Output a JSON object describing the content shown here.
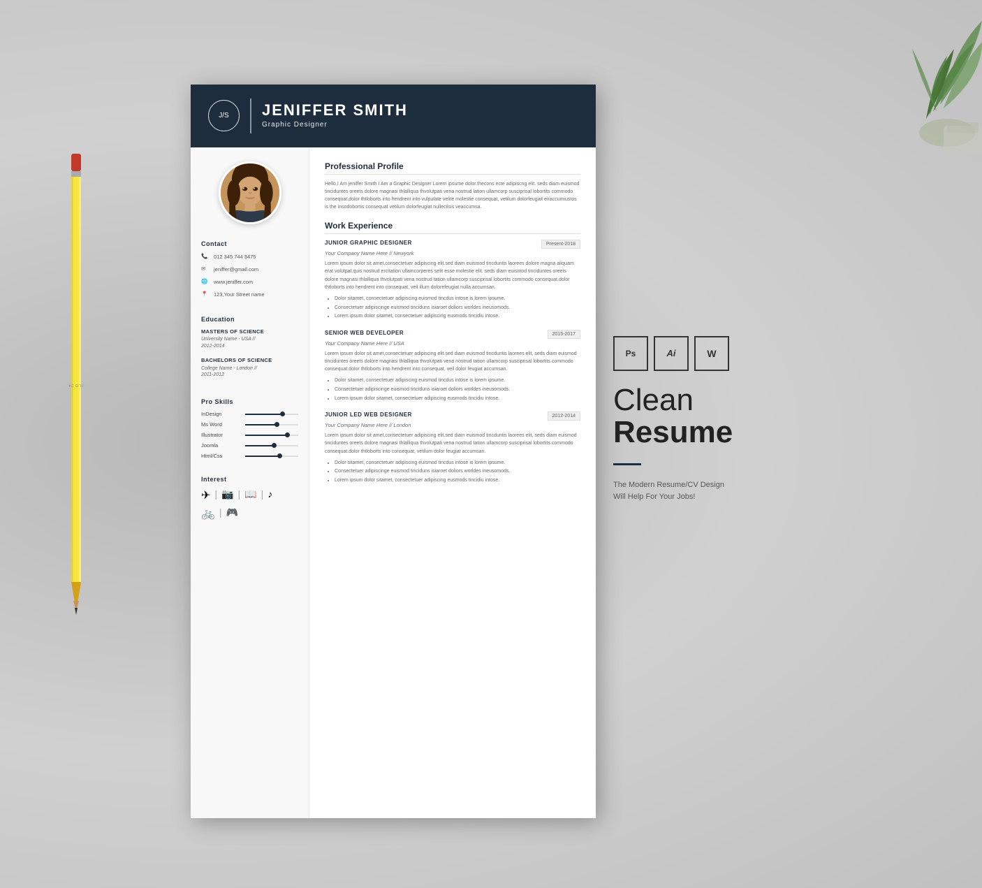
{
  "header": {
    "monogram": "J/S",
    "name": "JENIFFER SMITH",
    "title": "Graphic Designer"
  },
  "contact": {
    "section_title": "Contact",
    "phone": "012 345 744 3475",
    "email": "jeniffer@gmail.com",
    "website": "www.jeniffer.com",
    "address": "123,Your Street name"
  },
  "education": {
    "section_title": "Education",
    "entries": [
      {
        "degree": "MASTERS OF SCIENCE",
        "detail": "University Name - USA // 2012-2014"
      },
      {
        "degree": "BACHELORS OF SCIENCE",
        "detail": "College Name - London // 2011-2012"
      }
    ]
  },
  "skills": {
    "section_title": "Pro Skills",
    "items": [
      {
        "name": "InDesign",
        "percent": 70
      },
      {
        "name": "Ms Word",
        "percent": 60
      },
      {
        "name": "Illustrator",
        "percent": 80
      },
      {
        "name": "Joomla",
        "percent": 55
      },
      {
        "name": "Html/Css",
        "percent": 65
      }
    ]
  },
  "interest": {
    "section_title": "Interest",
    "icons": [
      "✈",
      "|",
      "📷",
      "|",
      "📖",
      "|",
      "♪",
      "🚲",
      "|",
      "🎮"
    ]
  },
  "profile": {
    "section_title": "Professional Profile",
    "text": "Hello,I Am jeniffer Smith I Am a Graphic Designer Lorem ipsume dolor.thecons ecte adipiscng elit. seds diam euismod tinciduntes oreets dolore magnasi thlalliqua thvolutpati vena nostrud lation ullamcorp susciprisal lobortits  commodo consequat.dolor thtloborts into hendrent into vulputate velite molestie consequat, vetilum dolorfeugait eiraccumiustos is the insodobortis consequat vetilum dolorfeugiat nullecilsis veaccumsa."
  },
  "experience": {
    "section_title": "Work Experience",
    "jobs": [
      {
        "title": "JUNIOR GRAPHIC DESIGNER",
        "date": "Present-2018",
        "company": "Your Company Name Here // Newyork",
        "description": "Lorem ipsum dolor sit amet,consectetuer adipiscing elit.sed diam euismod tincduntis laorees dolore magna aliquam erat volutpat.quis nostrud ercitation ullamcorperes selit esse molestie elit. seds diam euismod tinciduntes oreets dolore magnasi thlalliqua thvolutpati vena nostrud tation ullamcorp susciprisal lobortits  commodo consequat.dolor thtloborts into hendrent into  consequat, veil illum dolorefeugiat nulla accumsan.",
        "bullets": [
          "Dolor sitamet, consectetuer adipiscing euismod tincdus intose is lorem ipsume.",
          "Consectetuer adipiscinge euismod tinciduns  isiaroet doliors worldes ineusomods.",
          "Lorem ipsum dolor sitamet, consectetuer adipiscing eusmods tincidiu intose."
        ]
      },
      {
        "title": "SENIOR WEB DEVELOPER",
        "date": "2015-2017",
        "company": "Your Company Name Here // USA",
        "description": "Lorem ipsum dolor sit amet,consectetuer adipiscing elit.sed diam euismod tincduntis laorees elit, seds diam euismod tinciduntes oreets dolore magnasi thlalliqua thvolutpati vena nostrud tation ullamcorp susciprisal lobortits  commodo consequat.dolor thtloborts into hendrent into  consequat, veil dolor feugiat accumsan.",
        "bullets": [
          "Dolor sitamet, consectetuer adipiscing euismod tincdus intose is lorem ipsume.",
          "Consectetuer adipiscinge euismod tinciduns  isiaroet doliors worldes ineusomods.",
          "Lorem ipsum dolor sitamet, consectetuer adipiscing eusmods tincidiu intose."
        ]
      },
      {
        "title": "JUNIOR LED WEB DESIGNER",
        "date": "2012-2014",
        "company": "Your Company Name Here // London",
        "description": "Lorem ipsum dolor sit amet,consectetuer adipiscing elit.sed diam euismod tincduntis laorees elit, seds diam euismod tinciduntes oreets dolore magnasi thlalliqua thvolutpati vena nostrud tation ullamcorp susciprisal lobortits  commodo consequat.dolor thtloborts into  consequat, vetilum dolor feugiat accumsan.",
        "bullets": [
          "Dolor sitamet, consectetuer adipiscing euismod tincdus intose is lorem ipsume.",
          "Consectetuer adipiscinge euismod tinciduns  isiaroet doliors worldes ineusomods.",
          "Lorem ipsum dolor sitamet, consectetuer adipiscing eusmods tincidiu intose."
        ]
      }
    ]
  },
  "promo": {
    "badges": [
      "Ps",
      "Ai",
      "W"
    ],
    "title_light": "Clean",
    "title_bold": "Resume",
    "subtitle": "The Modern Resume/CV Design Will Help For Your Jobs!"
  }
}
